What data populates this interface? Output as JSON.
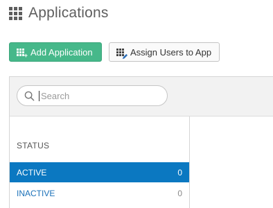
{
  "header": {
    "title": "Applications",
    "icon": "apps-grid-icon"
  },
  "toolbar": {
    "add_application_label": "Add Application",
    "assign_users_label": "Assign Users to App"
  },
  "search": {
    "placeholder": "Search",
    "value": ""
  },
  "status_filter": {
    "heading": "STATUS",
    "items": [
      {
        "label": "ACTIVE",
        "count": "0",
        "selected": true
      },
      {
        "label": "INACTIVE",
        "count": "0",
        "selected": false
      }
    ]
  },
  "colors": {
    "primary_button": "#46b88a",
    "selected_row": "#0b78c1",
    "link_text": "#1a70b8"
  }
}
